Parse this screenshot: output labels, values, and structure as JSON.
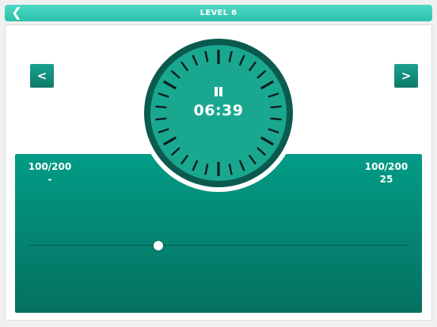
{
  "header": {
    "title": "LEVEL 6",
    "back_icon": "chevron-left-icon"
  },
  "nav": {
    "prev_label": "<",
    "next_label": ">"
  },
  "timer": {
    "time": "06:39",
    "state_icon": "pause-icon"
  },
  "stats": {
    "left": {
      "value": "100/200",
      "sub": "-"
    },
    "right": {
      "value": "100/200",
      "sub": "25"
    }
  },
  "slider": {
    "value_fraction": 0.34
  },
  "colors": {
    "header": "#2bbfa9",
    "accent": "#059a85",
    "accent_dark": "#0a5b4e",
    "background": "#f0f0f0"
  }
}
